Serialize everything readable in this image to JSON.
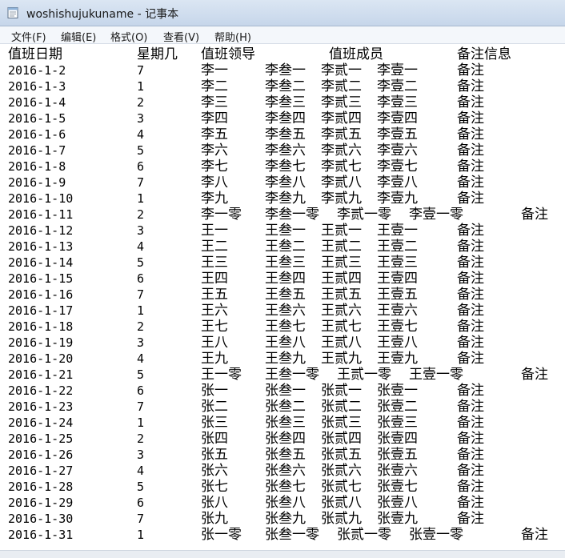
{
  "window": {
    "title": "woshishujukuname - 记事本"
  },
  "menu": [
    "文件(F)",
    "编辑(E)",
    "格式(O)",
    "查看(V)",
    "帮助(H)"
  ],
  "header": {
    "date": "值班日期",
    "weekday": "星期几",
    "leader": "值班领导",
    "members": "值班成员",
    "notes": "备注信息"
  },
  "rows": [
    {
      "date": "2016-1-2",
      "weekday": "7",
      "leader": "李一",
      "m1": "李叁一",
      "m2": "李贰一",
      "m3": "李壹一",
      "note": "备注"
    },
    {
      "date": "2016-1-3",
      "weekday": "1",
      "leader": "李二",
      "m1": "李叁二",
      "m2": "李贰二",
      "m3": "李壹二",
      "note": "备注"
    },
    {
      "date": "2016-1-4",
      "weekday": "2",
      "leader": "李三",
      "m1": "李叁三",
      "m2": "李贰三",
      "m3": "李壹三",
      "note": "备注"
    },
    {
      "date": "2016-1-5",
      "weekday": "3",
      "leader": "李四",
      "m1": "李叁四",
      "m2": "李贰四",
      "m3": "李壹四",
      "note": "备注"
    },
    {
      "date": "2016-1-6",
      "weekday": "4",
      "leader": "李五",
      "m1": "李叁五",
      "m2": "李贰五",
      "m3": "李壹五",
      "note": "备注"
    },
    {
      "date": "2016-1-7",
      "weekday": "5",
      "leader": "李六",
      "m1": "李叁六",
      "m2": "李贰六",
      "m3": "李壹六",
      "note": "备注"
    },
    {
      "date": "2016-1-8",
      "weekday": "6",
      "leader": "李七",
      "m1": "李叁七",
      "m2": "李贰七",
      "m3": "李壹七",
      "note": "备注"
    },
    {
      "date": "2016-1-9",
      "weekday": "7",
      "leader": "李八",
      "m1": "李叁八",
      "m2": "李贰八",
      "m3": "李壹八",
      "note": "备注"
    },
    {
      "date": "2016-1-10",
      "weekday": "1",
      "leader": "李九",
      "m1": "李叁九",
      "m2": "李贰九",
      "m3": "李壹九",
      "note": "备注"
    },
    {
      "date": "2016-1-11",
      "weekday": "2",
      "leader": "李一零",
      "m1": "李叁一零",
      "m2": "李贰一零",
      "m3": "李壹一零",
      "note": "备注"
    },
    {
      "date": "2016-1-12",
      "weekday": "3",
      "leader": "王一",
      "m1": "王叁一",
      "m2": "王贰一",
      "m3": "王壹一",
      "note": "备注"
    },
    {
      "date": "2016-1-13",
      "weekday": "4",
      "leader": "王二",
      "m1": "王叁二",
      "m2": "王贰二",
      "m3": "王壹二",
      "note": "备注"
    },
    {
      "date": "2016-1-14",
      "weekday": "5",
      "leader": "王三",
      "m1": "王叁三",
      "m2": "王贰三",
      "m3": "王壹三",
      "note": "备注"
    },
    {
      "date": "2016-1-15",
      "weekday": "6",
      "leader": "王四",
      "m1": "王叁四",
      "m2": "王贰四",
      "m3": "王壹四",
      "note": "备注"
    },
    {
      "date": "2016-1-16",
      "weekday": "7",
      "leader": "王五",
      "m1": "王叁五",
      "m2": "王贰五",
      "m3": "王壹五",
      "note": "备注"
    },
    {
      "date": "2016-1-17",
      "weekday": "1",
      "leader": "王六",
      "m1": "王叁六",
      "m2": "王贰六",
      "m3": "王壹六",
      "note": "备注"
    },
    {
      "date": "2016-1-18",
      "weekday": "2",
      "leader": "王七",
      "m1": "王叁七",
      "m2": "王贰七",
      "m3": "王壹七",
      "note": "备注"
    },
    {
      "date": "2016-1-19",
      "weekday": "3",
      "leader": "王八",
      "m1": "王叁八",
      "m2": "王贰八",
      "m3": "王壹八",
      "note": "备注"
    },
    {
      "date": "2016-1-20",
      "weekday": "4",
      "leader": "王九",
      "m1": "王叁九",
      "m2": "王贰九",
      "m3": "王壹九",
      "note": "备注"
    },
    {
      "date": "2016-1-21",
      "weekday": "5",
      "leader": "王一零",
      "m1": "王叁一零",
      "m2": "王贰一零",
      "m3": "王壹一零",
      "note": "备注"
    },
    {
      "date": "2016-1-22",
      "weekday": "6",
      "leader": "张一",
      "m1": "张叁一",
      "m2": "张贰一",
      "m3": "张壹一",
      "note": "备注"
    },
    {
      "date": "2016-1-23",
      "weekday": "7",
      "leader": "张二",
      "m1": "张叁二",
      "m2": "张贰二",
      "m3": "张壹二",
      "note": "备注"
    },
    {
      "date": "2016-1-24",
      "weekday": "1",
      "leader": "张三",
      "m1": "张叁三",
      "m2": "张贰三",
      "m3": "张壹三",
      "note": "备注"
    },
    {
      "date": "2016-1-25",
      "weekday": "2",
      "leader": "张四",
      "m1": "张叁四",
      "m2": "张贰四",
      "m3": "张壹四",
      "note": "备注"
    },
    {
      "date": "2016-1-26",
      "weekday": "3",
      "leader": "张五",
      "m1": "张叁五",
      "m2": "张贰五",
      "m3": "张壹五",
      "note": "备注"
    },
    {
      "date": "2016-1-27",
      "weekday": "4",
      "leader": "张六",
      "m1": "张叁六",
      "m2": "张贰六",
      "m3": "张壹六",
      "note": "备注"
    },
    {
      "date": "2016-1-28",
      "weekday": "5",
      "leader": "张七",
      "m1": "张叁七",
      "m2": "张贰七",
      "m3": "张壹七",
      "note": "备注"
    },
    {
      "date": "2016-1-29",
      "weekday": "6",
      "leader": "张八",
      "m1": "张叁八",
      "m2": "张贰八",
      "m3": "张壹八",
      "note": "备注"
    },
    {
      "date": "2016-1-30",
      "weekday": "7",
      "leader": "张九",
      "m1": "张叁九",
      "m2": "张贰九",
      "m3": "张壹九",
      "note": "备注"
    },
    {
      "date": "2016-1-31",
      "weekday": "1",
      "leader": "张一零",
      "m1": "张叁一零",
      "m2": "张贰一零",
      "m3": "张壹一零",
      "note": "备注"
    }
  ]
}
